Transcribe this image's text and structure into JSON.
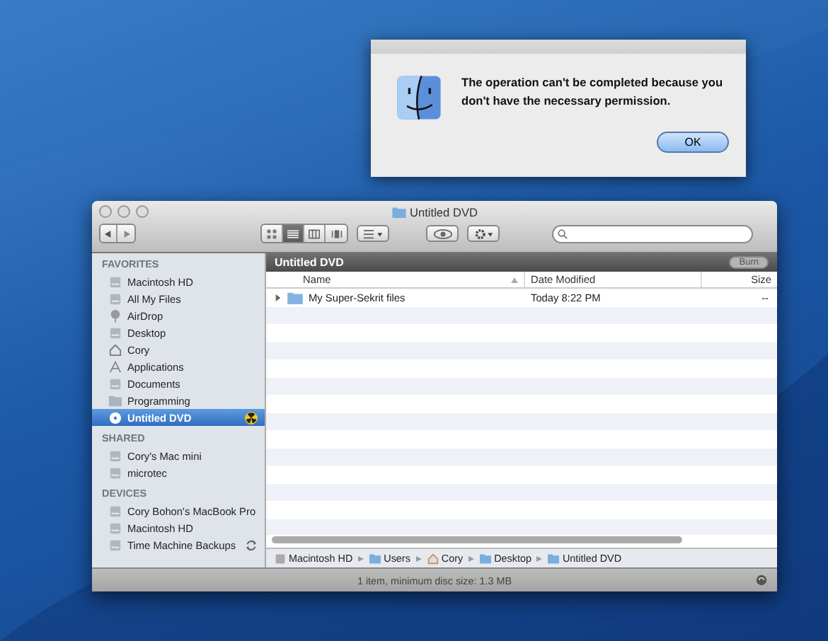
{
  "dialog": {
    "message": "The operation can't be completed because you don't have the necessary permission.",
    "button": "OK"
  },
  "finder": {
    "title": "Untitled DVD",
    "view_buttons": [
      {
        "selected": false
      },
      {
        "selected": true
      },
      {
        "selected": false
      },
      {
        "selected": false
      }
    ],
    "sidebar": [
      {
        "heading": "FAVORITES",
        "items": [
          {
            "label": "Macintosh HD",
            "selected": false
          },
          {
            "label": "All My Files",
            "selected": false
          },
          {
            "label": "AirDrop",
            "selected": false
          },
          {
            "label": "Desktop",
            "selected": false
          },
          {
            "label": "Cory",
            "selected": false
          },
          {
            "label": "Applications",
            "selected": false
          },
          {
            "label": "Documents",
            "selected": false
          },
          {
            "label": "Programming",
            "selected": false
          },
          {
            "label": "Untitled DVD",
            "selected": true,
            "burning": true
          }
        ]
      },
      {
        "heading": "SHARED",
        "items": [
          {
            "label": "Cory's Mac mini",
            "selected": false
          },
          {
            "label": "microtec",
            "selected": false
          }
        ]
      },
      {
        "heading": "DEVICES",
        "items": [
          {
            "label": "Cory Bohon's MacBook Pro",
            "selected": false
          },
          {
            "label": "Macintosh HD",
            "selected": false
          },
          {
            "label": "Time Machine Backups",
            "selected": false,
            "syncing": true
          }
        ]
      }
    ],
    "header": {
      "title": "Untitled DVD",
      "button": "Burn",
      "disabled": true
    },
    "columns": [
      {
        "label": "Name",
        "sorted": true
      },
      {
        "label": "Date Modified",
        "sorted": false
      },
      {
        "label": "Size",
        "sorted": false
      }
    ],
    "rows": [
      {
        "name": "My Super-Sekrit files",
        "date": "Today 8:22 PM",
        "size": "--",
        "expanded": false
      }
    ],
    "path": [
      "Macintosh HD",
      "Users",
      "Cory",
      "Desktop",
      "Untitled DVD"
    ],
    "status": "1 item, minimum disc size: 1.3 MB"
  }
}
